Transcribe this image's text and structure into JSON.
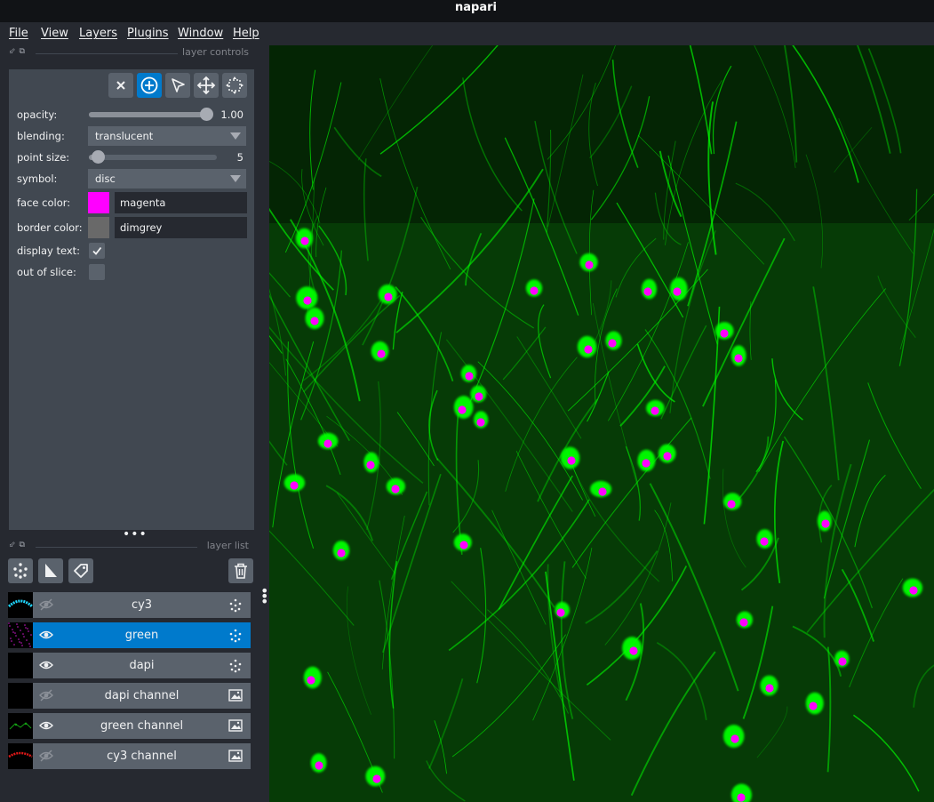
{
  "app": {
    "title": "napari"
  },
  "menu": [
    "File",
    "View",
    "Plugins",
    "Window",
    "Help",
    "Layers"
  ],
  "layer_controls": {
    "header": "layer controls",
    "mode_buttons": [
      "delete-selected",
      "add-points",
      "select-points",
      "pan-zoom",
      "transform"
    ],
    "opacity": {
      "label": "opacity:",
      "value": "1.00",
      "fraction": 1.0
    },
    "blending": {
      "label": "blending:",
      "value": "translucent"
    },
    "point_size": {
      "label": "point size:",
      "value": "5",
      "fraction": 0.07
    },
    "symbol": {
      "label": "symbol:",
      "value": "disc"
    },
    "face_color": {
      "label": "face color:",
      "value": "magenta",
      "swatch": "#ff00ff"
    },
    "border_color": {
      "label": "border color:",
      "value": "dimgrey",
      "swatch": "#696969"
    },
    "display_text": {
      "label": "display text:",
      "checked": true
    },
    "out_of_slice": {
      "label": "out of slice:",
      "checked": false
    }
  },
  "layer_list": {
    "header": "layer list",
    "tool_buttons": [
      "new-points-layer-icon",
      "new-shapes-layer-icon",
      "new-labels-layer-icon",
      "delete-layer-icon"
    ],
    "layers": [
      {
        "name": "cy3",
        "visible": false,
        "type": "points",
        "selected": false,
        "thumb": "cyan"
      },
      {
        "name": "green",
        "visible": true,
        "type": "points",
        "selected": true,
        "thumb": "magenta"
      },
      {
        "name": "dapi",
        "visible": true,
        "type": "points",
        "selected": false,
        "thumb": "black"
      },
      {
        "name": "dapi channel",
        "visible": false,
        "type": "image",
        "selected": false,
        "thumb": "black"
      },
      {
        "name": "green channel",
        "visible": true,
        "type": "image",
        "selected": false,
        "thumb": "green"
      },
      {
        "name": "cy3 channel",
        "visible": false,
        "type": "image",
        "selected": false,
        "thumb": "red"
      }
    ]
  },
  "colors": {
    "accent": "#007acc",
    "panel": "#414851",
    "background": "#262930",
    "point_face": "#ff00ff",
    "cell_green": "#00ff00"
  }
}
